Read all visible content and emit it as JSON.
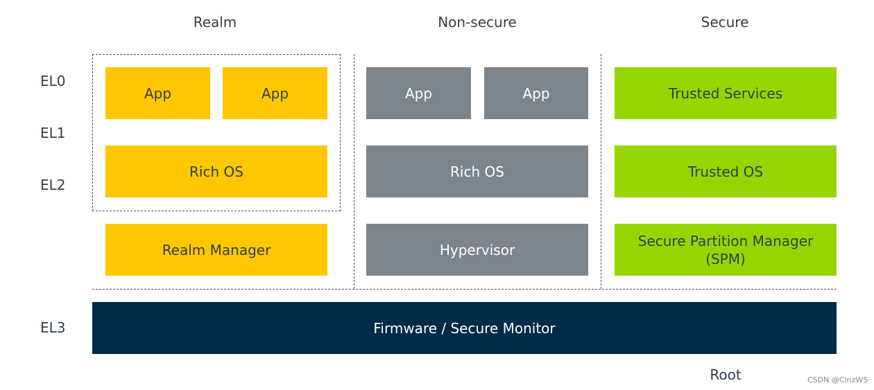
{
  "worlds": {
    "realm": "Realm",
    "non_secure": "Non-secure",
    "secure": "Secure",
    "root": "Root"
  },
  "levels": {
    "el0": "EL0",
    "el1": "EL1",
    "el2": "EL2",
    "el3": "EL3"
  },
  "realm": {
    "app1": "App",
    "app2": "App",
    "rich_os": "Rich OS",
    "manager": "Realm Manager"
  },
  "non_secure": {
    "app1": "App",
    "app2": "App",
    "rich_os": "Rich OS",
    "hypervisor": "Hypervisor"
  },
  "secure": {
    "trusted_services": "Trusted Services",
    "trusted_os": "Trusted OS",
    "spm_line1": "Secure Partition Manager",
    "spm_line2": "(SPM)"
  },
  "firmware": "Firmware / Secure Monitor",
  "watermark": "CSDN @CinzWS",
  "colors": {
    "realm": "#ffc700",
    "non_secure": "#7d858c",
    "secure": "#95d600",
    "root": "#002b49"
  }
}
